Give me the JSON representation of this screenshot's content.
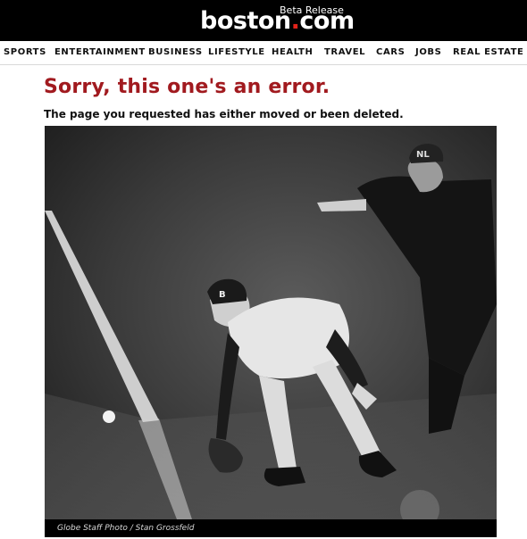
{
  "header": {
    "logo_text": "boston",
    "logo_dot": ".",
    "logo_suffix": "com",
    "beta_label": "Beta Release"
  },
  "nav": {
    "items": [
      "SPORTS",
      "ENTERTAINMENT",
      "BUSINESS",
      "LIFESTYLE",
      "HEALTH",
      "TRAVEL",
      "CARS",
      "JOBS",
      "REAL ESTATE"
    ]
  },
  "main": {
    "title": "Sorry, this one's an error.",
    "subtitle": "The page you requested has either moved or been deleted.",
    "photo_caption": "Globe Staff Photo / Stan Grossfeld"
  },
  "colors": {
    "brand_red": "#e2231a",
    "title_red": "#a11a1f",
    "header_bg": "#000000"
  }
}
